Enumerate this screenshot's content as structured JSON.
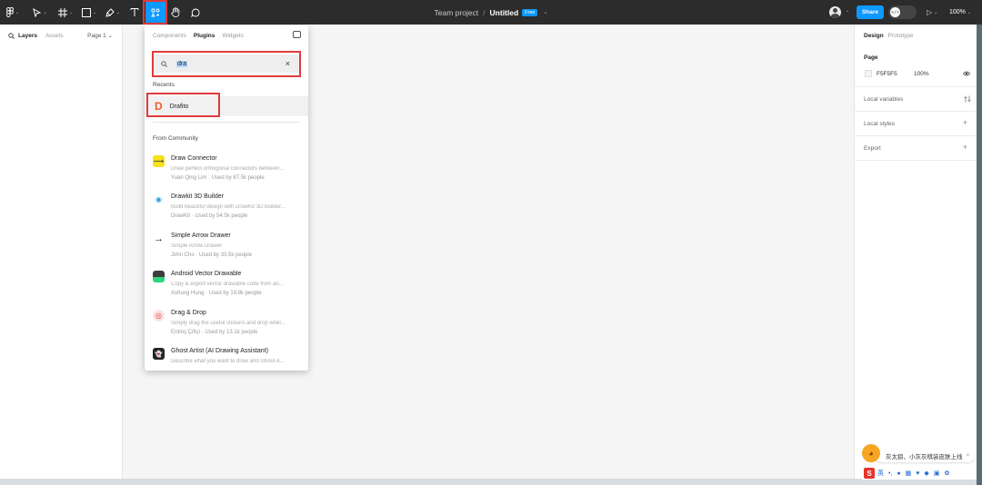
{
  "toolbar": {
    "caret": "⌄",
    "project": "Team project",
    "separator": "/",
    "file": "Untitled",
    "plan_badge": "Free",
    "share": "Share",
    "dev_icon": "</>",
    "play_icon": "▷",
    "zoom": "100%",
    "accent": "#0d99ff"
  },
  "left_panel": {
    "tab_layers": "Layers",
    "tab_assets": "Assets",
    "page": "Page 1 ⌄"
  },
  "plugin_panel": {
    "tabs": [
      "Components",
      "Plugins",
      "Widgets"
    ],
    "active_tab": "Plugins",
    "search_value": "dra",
    "recents_label": "Recents",
    "recent": {
      "name": "Drafito",
      "icon": "D"
    },
    "community_label": "From Community",
    "plugins": [
      {
        "name": "Draw Connector",
        "desc": "Draw perfect orthogonal connectors between...",
        "meta": "Yuan Qing Lim · Used by 87.5k people",
        "icon": "⟿"
      },
      {
        "name": "Drawkit 3D Builder",
        "desc": "Build beautiful design with DrawKit 3D builder...",
        "meta": "DrawKit · Used by 54.5k people",
        "icon": "◉"
      },
      {
        "name": "Simple Arrow Drawer",
        "desc": "Simple Arrow Drawer",
        "meta": "John Cho · Used by 33.5k people",
        "icon": "→"
      },
      {
        "name": "Android Vector Drawable",
        "desc": "Copy & export vector drawable code from an...",
        "meta": "Ashung Hung · Used by 19.8k people",
        "icon": "▂"
      },
      {
        "name": "Drag & Drop",
        "desc": "Simply drag the useful stickers and drop wher...",
        "meta": "Erdinç Çiftçi · Used by 13.1k people",
        "icon": "◎"
      },
      {
        "name": "Ghost Artist (AI Drawing Assistant)",
        "desc": "Describe what you want to draw and Ghost A...",
        "meta": "",
        "icon": "👻"
      }
    ]
  },
  "right_panel": {
    "tab_design": "Design",
    "tab_prototype": "Prototype",
    "page_label": "Page",
    "page_color": "F5F5F5",
    "page_opacity": "100%",
    "local_variables": "Local variables",
    "local_styles": "Local styles",
    "export": "Export"
  },
  "ime": {
    "notice": "灰太狼、小灰灰棋装皮肤上线",
    "mode": "英",
    "close": "×"
  }
}
